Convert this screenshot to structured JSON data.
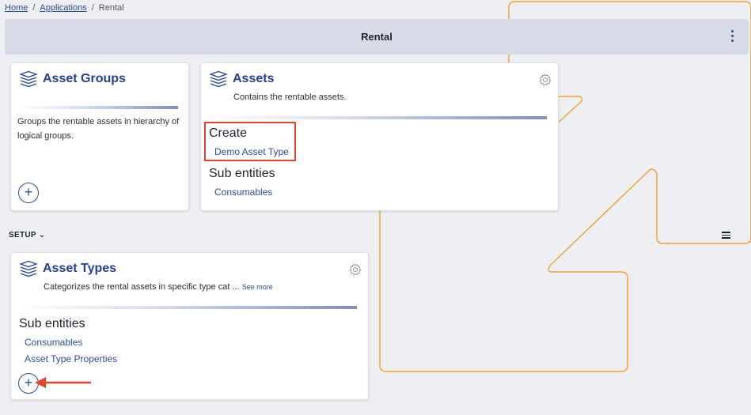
{
  "breadcrumb": {
    "home": "Home",
    "applications": "Applications",
    "current": "Rental"
  },
  "header": {
    "title": "Rental"
  },
  "asset_groups": {
    "title": "Asset Groups",
    "description": "Groups the rentable assets in hierarchy of logical groups.",
    "add_label": "+"
  },
  "assets": {
    "title": "Assets",
    "description": "Contains the rentable assets.",
    "create_heading": "Create",
    "create_links": [
      "Demo Asset Type"
    ],
    "sub_heading": "Sub entities",
    "sub_links": [
      "Consumables"
    ]
  },
  "setup": {
    "label": "SETUP",
    "chevron": "⌄"
  },
  "asset_types": {
    "title": "Asset Types",
    "description": "Categorizes the rental assets in specific type cat ...",
    "see_more": "See more",
    "sub_heading": "Sub entities",
    "sub_links": [
      "Consumables",
      "Asset Type Properties"
    ],
    "add_label": "+"
  },
  "icons": [
    "layers-icon",
    "gear-icon",
    "plus-icon",
    "kebab-menu-icon",
    "hamburger-menu-icon",
    "chevron-down-icon"
  ],
  "colors": {
    "accent": "#2a4d9b",
    "header_bg": "#d6dbe5",
    "annotation": "#e0462b",
    "decor": "#f0a43a"
  }
}
